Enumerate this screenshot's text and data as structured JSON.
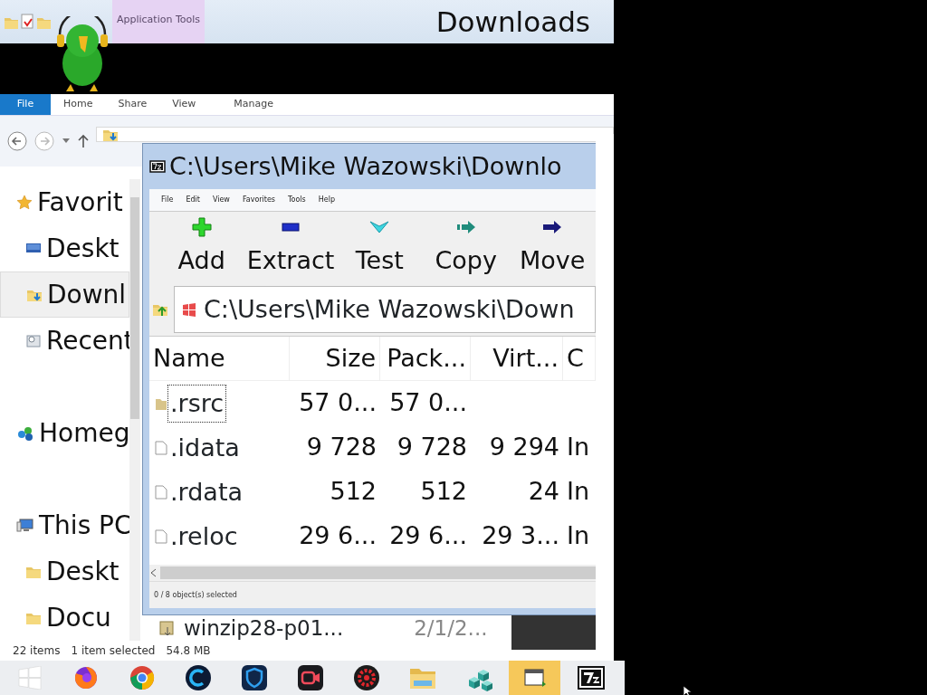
{
  "explorer": {
    "title": "Downloads",
    "context_tab": "Application Tools",
    "ribbon_tabs": [
      {
        "label": "File",
        "kind": "file"
      },
      {
        "label": "Home",
        "kind": "tab"
      },
      {
        "label": "Share",
        "kind": "tab"
      },
      {
        "label": "View",
        "kind": "tab"
      },
      {
        "label": "Manage",
        "kind": "context"
      }
    ],
    "nav": [
      {
        "label": "Favorit",
        "kind": "star",
        "selected": false,
        "children": [
          {
            "label": "Deskt",
            "kind": "desktop",
            "selected": false
          },
          {
            "label": "Downl",
            "kind": "downloads",
            "selected": true
          },
          {
            "label": "Recent",
            "kind": "recent",
            "selected": false
          }
        ]
      },
      {
        "label": "Homeg",
        "kind": "homegroup",
        "selected": false
      },
      {
        "label": "This PC",
        "kind": "pc",
        "selected": false,
        "children": [
          {
            "label": "Deskt",
            "kind": "folder",
            "selected": false
          },
          {
            "label": "Docu",
            "kind": "folder",
            "selected": false
          }
        ]
      }
    ],
    "file_peek": {
      "name": "winzip28-p01...",
      "date": "2/1/2..."
    },
    "status": {
      "count": "22 items",
      "selection": "1 item selected",
      "size": "54.8 MB"
    }
  },
  "sevenzip": {
    "title": "C:\\Users\\Mike Wazowski\\Downlo",
    "menu": [
      "File",
      "Edit",
      "View",
      "Favorites",
      "Tools",
      "Help"
    ],
    "toolbar": [
      {
        "label": "Add",
        "kind": "add"
      },
      {
        "label": "Extract",
        "kind": "extract"
      },
      {
        "label": "Test",
        "kind": "test"
      },
      {
        "label": "Copy",
        "kind": "copy"
      },
      {
        "label": "Move",
        "kind": "move"
      }
    ],
    "path": "C:\\Users\\Mike Wazowski\\Down",
    "columns": [
      "Name",
      "Size",
      "Pack...",
      "Virt...",
      "C"
    ],
    "rows": [
      {
        "kind": "folder",
        "focused": true,
        "name": ".rsrc",
        "size": "57 0...",
        "packed": "57 0..."
      },
      {
        "kind": "file",
        "focused": false,
        "name": ".idata",
        "size": "9 728",
        "packed": "9 728",
        "virtual": "9 294",
        "characteristics": "In"
      },
      {
        "kind": "file",
        "focused": false,
        "name": ".rdata",
        "size": "512",
        "packed": "512",
        "virtual": "24",
        "characteristics": "In"
      },
      {
        "kind": "file",
        "focused": false,
        "name": ".reloc",
        "size": "29 6...",
        "packed": "29 6...",
        "virtual": "29 3...",
        "characteristics": "In"
      }
    ],
    "status": "0 / 8 object(s) selected"
  },
  "taskbar": [
    {
      "kind": "start",
      "active": false
    },
    {
      "kind": "firefox",
      "active": false
    },
    {
      "kind": "chrome",
      "active": false
    },
    {
      "kind": "ring",
      "active": false
    },
    {
      "kind": "shield",
      "active": false
    },
    {
      "kind": "camera",
      "active": false
    },
    {
      "kind": "gear",
      "active": false
    },
    {
      "kind": "explorer",
      "active": false
    },
    {
      "kind": "cubes",
      "active": false
    },
    {
      "kind": "folder",
      "active": true
    },
    {
      "kind": "sevenzip",
      "active": false
    }
  ]
}
